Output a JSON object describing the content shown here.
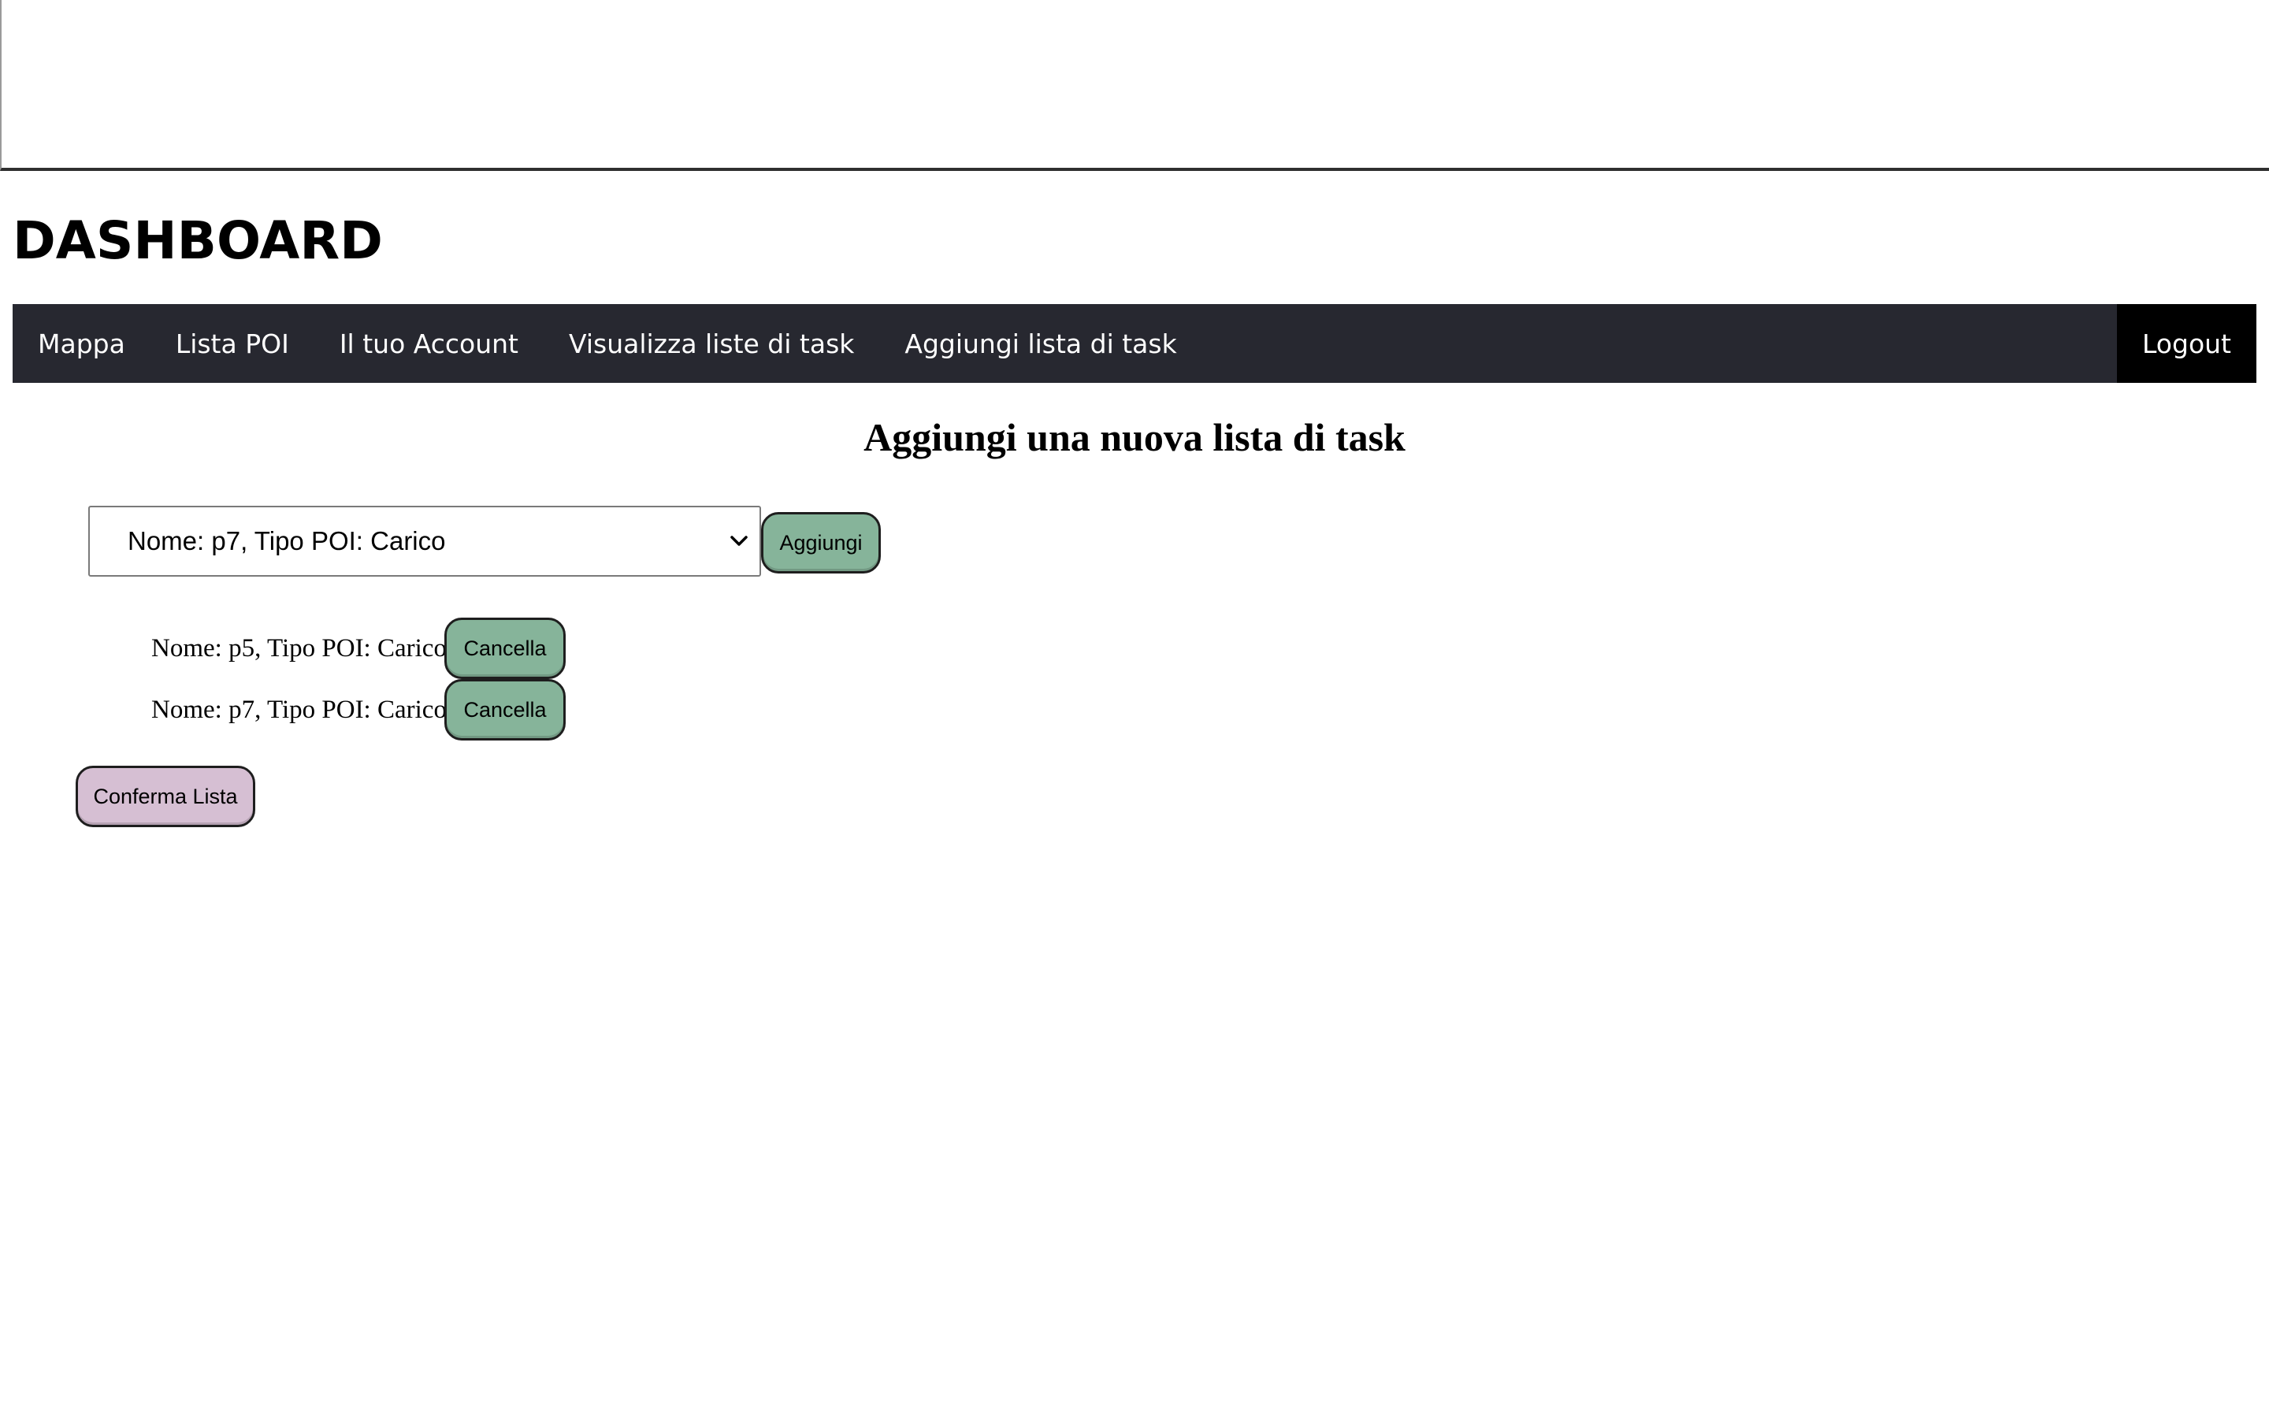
{
  "header": {
    "title": "DASHBOARD"
  },
  "nav": {
    "items": [
      {
        "label": "Mappa"
      },
      {
        "label": "Lista POI"
      },
      {
        "label": "Il tuo Account"
      },
      {
        "label": "Visualizza liste di task"
      },
      {
        "label": "Aggiungi lista di task"
      }
    ],
    "logout_label": "Logout"
  },
  "main": {
    "heading": "Aggiungi una nuova lista di task",
    "poi_select": {
      "selected_value": "Nome: p7, Tipo POI: Carico",
      "icon": "chevron-down-icon"
    },
    "add_button_label": "Aggiungi",
    "tasks": [
      {
        "label": "Nome: p5, Tipo POI: Carico",
        "delete_label": "Cancella"
      },
      {
        "label": "Nome: p7, Tipo POI: Carico",
        "delete_label": "Cancella"
      }
    ],
    "confirm_button_label": "Conferma Lista"
  },
  "colors": {
    "navbar_bg": "#272830",
    "logout_bg": "#000000",
    "green_button": "#86b49a",
    "pink_button": "#d6bfd3"
  }
}
